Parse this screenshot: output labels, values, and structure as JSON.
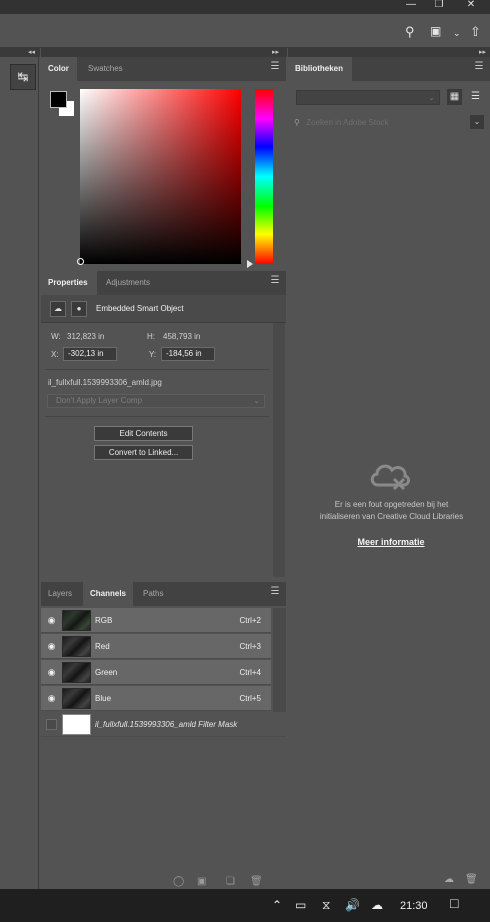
{
  "window": {
    "minimize_icon": "minimize-icon",
    "restore_icon": "restore-icon",
    "close_icon": "close-icon"
  },
  "options_bar": {
    "icons": [
      "search-icon",
      "workspace-icon",
      "chevron-down-icon",
      "share-icon"
    ]
  },
  "toolbar": {
    "tool_icon": "history-icon"
  },
  "color_panel": {
    "tabs": [
      "Color",
      "Swatches"
    ],
    "foreground": "#000000",
    "background": "#ffffff"
  },
  "properties_panel": {
    "tabs": [
      "Properties",
      "Adjustments"
    ],
    "title": "Embedded Smart Object",
    "w_label": "W:",
    "w_value": "312,823 in",
    "h_label": "H:",
    "h_value": "458,793 in",
    "x_label": "X:",
    "x_value": "-302,13 in",
    "y_label": "Y:",
    "y_value": "-184,56 in",
    "filename": "il_fullxfull.1539993306_amld.jpg",
    "layer_comp": "Don't Apply Layer Comp",
    "edit_contents": "Edit Contents",
    "convert_linked": "Convert to Linked..."
  },
  "channels_panel": {
    "tabs": [
      "Layers",
      "Channels",
      "Paths"
    ],
    "rows": [
      {
        "name": "RGB",
        "shortcut": "Ctrl+2"
      },
      {
        "name": "Red",
        "shortcut": "Ctrl+3"
      },
      {
        "name": "Green",
        "shortcut": "Ctrl+4"
      },
      {
        "name": "Blue",
        "shortcut": "Ctrl+5"
      }
    ],
    "mask_name": "il_fullxfull.1539993306_amld  Filter Mask"
  },
  "libraries_panel": {
    "tab": "Bibliotheken",
    "search_placeholder": "Zoeken in Adobe Stock",
    "error_line1": "Er is een fout opgetreden bij het",
    "error_line2": "initialiseren van Creative Cloud Libraries",
    "link": "Meer informatie"
  },
  "taskbar": {
    "time": "21:30"
  }
}
